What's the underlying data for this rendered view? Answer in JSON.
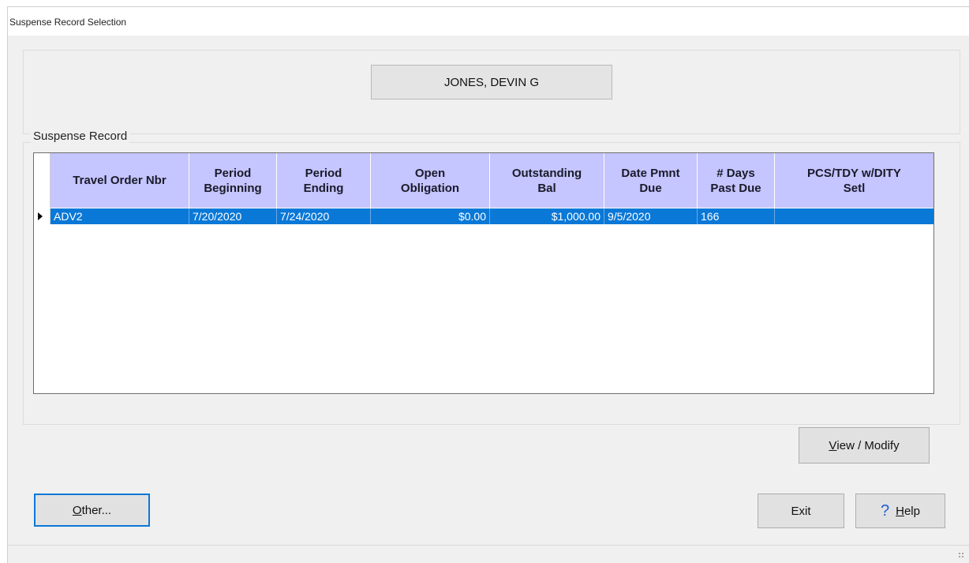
{
  "window": {
    "title": "Suspense Record Selection"
  },
  "member": {
    "name": "JONES, DEVIN G"
  },
  "suspense_group": {
    "label": "Suspense Record"
  },
  "grid": {
    "columns": [
      {
        "label": "Travel Order Nbr"
      },
      {
        "label": "Period\nBeginning"
      },
      {
        "label": "Period\nEnding"
      },
      {
        "label": "Open\nObligation"
      },
      {
        "label": "Outstanding\nBal"
      },
      {
        "label": "Date Pmnt\nDue"
      },
      {
        "label": "# Days\nPast Due"
      },
      {
        "label": "PCS/TDY w/DITY\nSetl"
      }
    ],
    "rows": [
      {
        "travel_order_nbr": "ADV2",
        "period_beginning": "7/20/2020",
        "period_ending": "7/24/2020",
        "open_obligation": "$0.00",
        "outstanding_bal": "$1,000.00",
        "date_pmnt_due": "9/5/2020",
        "days_past_due": "166",
        "pcs_tdy_setl": ""
      }
    ],
    "selected_row_color": "#0a78d7",
    "header_color": "#c5c5ff"
  },
  "buttons": {
    "view_modify": {
      "access_key": "V",
      "rest": "iew / Modify"
    },
    "other": {
      "access_key": "O",
      "rest": "ther..."
    },
    "exit": {
      "label": "Exit"
    },
    "help": {
      "icon": "question-mark-icon",
      "access_key": "H",
      "rest": "elp"
    }
  }
}
